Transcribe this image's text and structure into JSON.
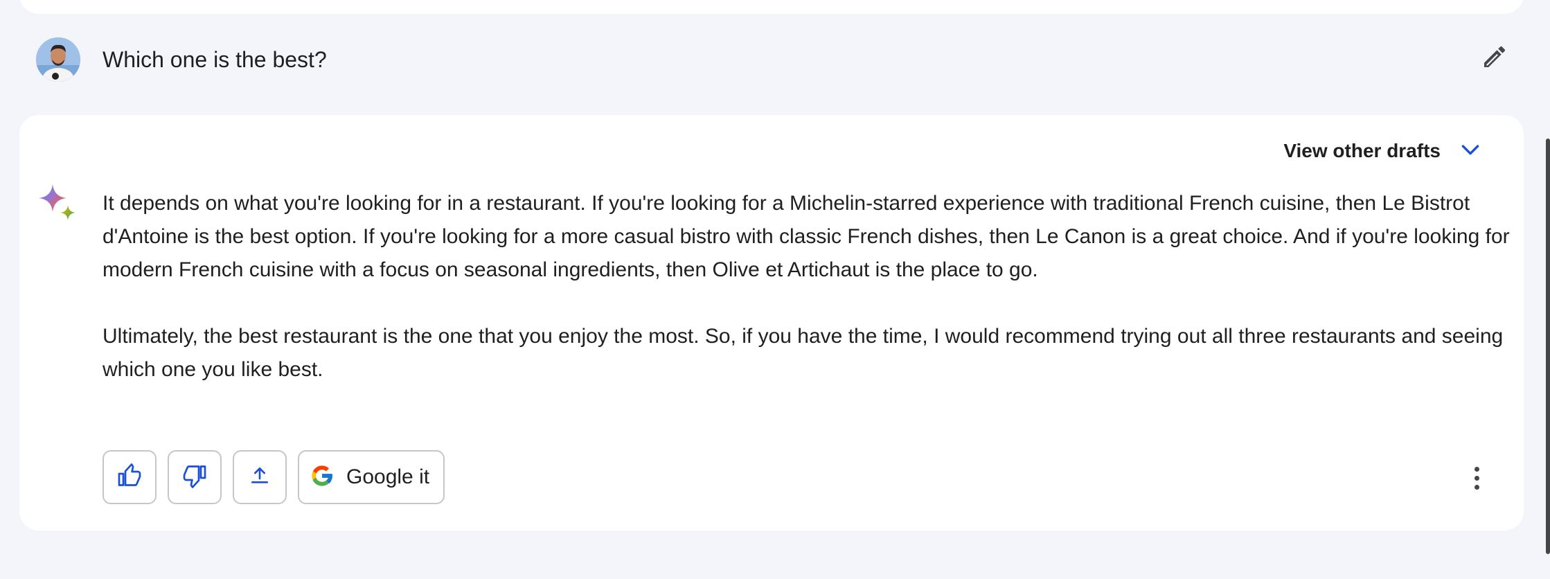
{
  "user_prompt": {
    "text": "Which one is the best?",
    "avatar_icon": "user-avatar",
    "edit_icon": "pencil-icon"
  },
  "response": {
    "drafts_label": "View other drafts",
    "drafts_icon": "chevron-down-icon",
    "paragraphs": [
      "It depends on what you're looking for in a restaurant. If you're looking for a Michelin-starred experience with traditional French cuisine, then Le Bistrot d'Antoine is the best option. If you're looking for a more casual bistro with classic French dishes, then Le Canon is a great choice. And if you're looking for modern French cuisine with a focus on seasonal ingredients, then Olive et Artichaut is the place to go.",
      "Ultimately, the best restaurant is the one that you enjoy the most. So, if you have the time, I would recommend trying out all three restaurants and seeing which one you like best."
    ],
    "actions": {
      "thumbs_up_icon": "thumbs-up-icon",
      "thumbs_down_icon": "thumbs-down-icon",
      "share_icon": "share-icon",
      "google_label": "Google it",
      "more_icon": "more-vert-icon"
    }
  },
  "colors": {
    "page_bg": "#f3f5fb",
    "card_bg": "#ffffff",
    "accent_blue": "#1a4fd6",
    "text": "#1f1f1f"
  }
}
